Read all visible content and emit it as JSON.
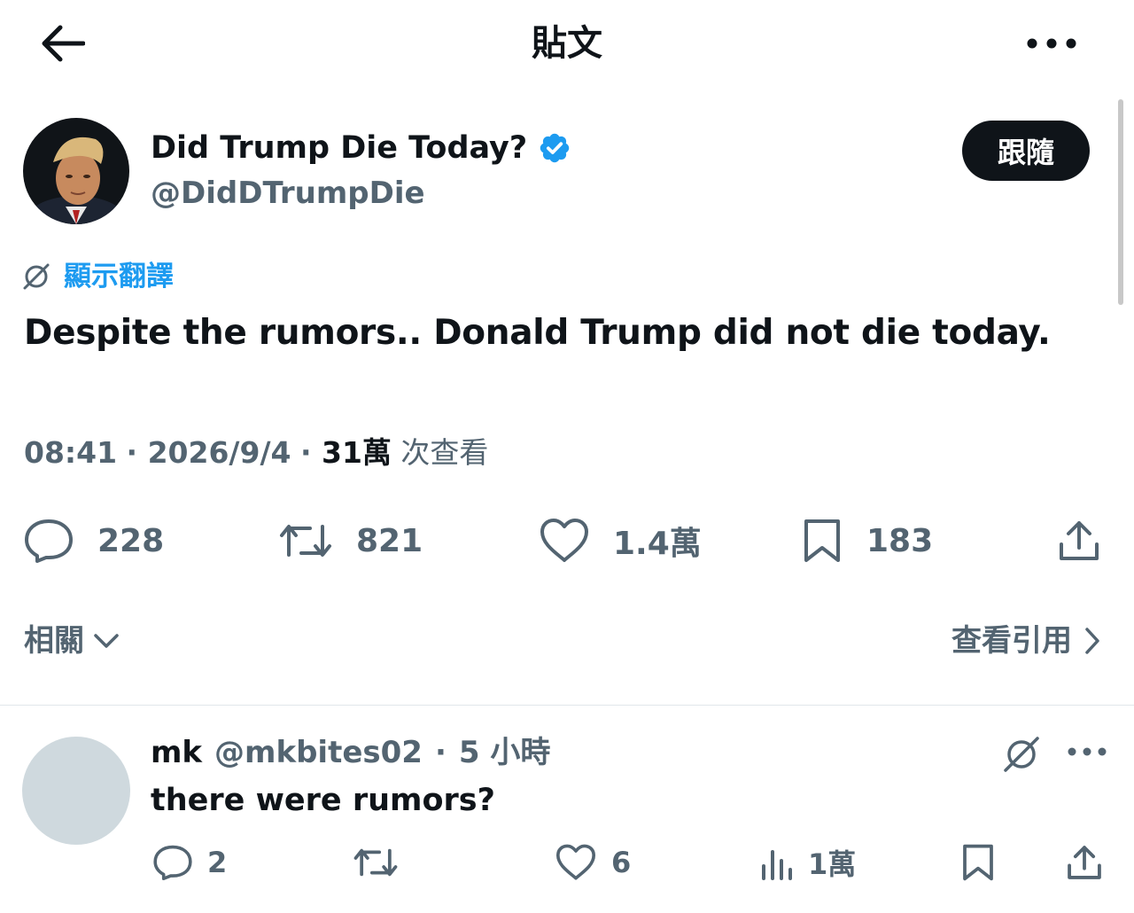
{
  "header": {
    "title": "貼文"
  },
  "tweet": {
    "author_name": "Did Trump Die Today?",
    "author_handle": "@DidDTrumpDie",
    "follow_label": "跟隨",
    "translate_label": "顯示翻譯",
    "text": "Despite the rumors.. Donald Trump did not die today.",
    "time": "08:41",
    "date": "2026/9/4",
    "views_count": "31萬",
    "views_label": "次查看",
    "stats": {
      "replies": "228",
      "retweets": "821",
      "likes": "1.4萬",
      "bookmarks": "183"
    },
    "related_label": "相關",
    "quotes_label": "查看引用"
  },
  "reply": {
    "name": "mk",
    "handle": "@mkbites02",
    "time": "5 小時",
    "text": "there were rumors?",
    "stats": {
      "replies": "2",
      "likes": "6",
      "views": "1萬"
    }
  },
  "colors": {
    "text_primary": "#0f1419",
    "text_secondary": "#536471",
    "accent_blue": "#1d9bf0",
    "follow_bg": "#0f1419",
    "avatar_placeholder": "#cfd9de"
  },
  "icons": [
    "back-arrow-icon",
    "more-icon",
    "verified-badge-icon",
    "translate-icon",
    "reply-icon",
    "retweet-icon",
    "like-icon",
    "bookmark-icon",
    "share-icon",
    "chevron-down-icon",
    "chevron-right-icon",
    "analytics-icon"
  ]
}
